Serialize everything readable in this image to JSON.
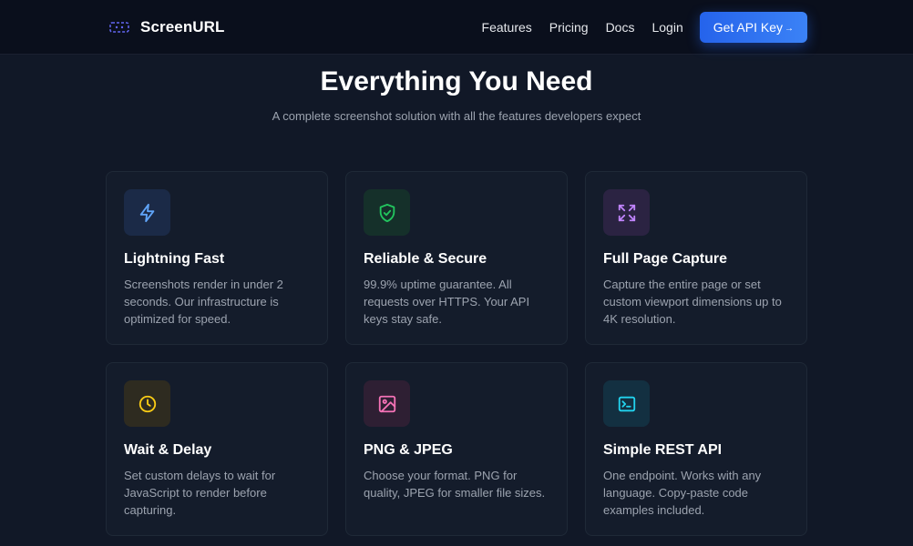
{
  "nav": {
    "brand": "ScreenURL",
    "links": [
      "Features",
      "Pricing",
      "Docs",
      "Login"
    ],
    "cta_label": "Get API Key",
    "cta_arrow": "→"
  },
  "hero": {
    "title": "Everything You Need",
    "subtitle": "A complete screenshot solution with all the features developers expect"
  },
  "features": [
    {
      "icon": "lightning-icon",
      "color": "#60a5fa",
      "bg": "#1b2a47",
      "title": "Lightning Fast",
      "description": "Screenshots render in under 2 seconds. Our infrastructure is optimized for speed."
    },
    {
      "icon": "shield-check-icon",
      "color": "#22c55e",
      "bg": "#15302a",
      "title": "Reliable & Secure",
      "description": "99.9% uptime guarantee. All requests over HTTPS. Your API keys stay safe."
    },
    {
      "icon": "expand-icon",
      "color": "#c084fc",
      "bg": "#2b2342",
      "title": "Full Page Capture",
      "description": "Capture the entire page or set custom viewport dimensions up to 4K resolution."
    },
    {
      "icon": "clock-icon",
      "color": "#facc15",
      "bg": "#2e2b20",
      "title": "Wait & Delay",
      "description": "Set custom delays to wait for JavaScript to render before capturing."
    },
    {
      "icon": "image-icon",
      "color": "#f472b6",
      "bg": "#2e1f33",
      "title": "PNG & JPEG",
      "description": "Choose your format. PNG for quality, JPEG for smaller file sizes."
    },
    {
      "icon": "terminal-icon",
      "color": "#22d3ee",
      "bg": "#133041",
      "title": "Simple REST API",
      "description": "One endpoint. Works with any language. Copy-paste code examples included."
    }
  ]
}
